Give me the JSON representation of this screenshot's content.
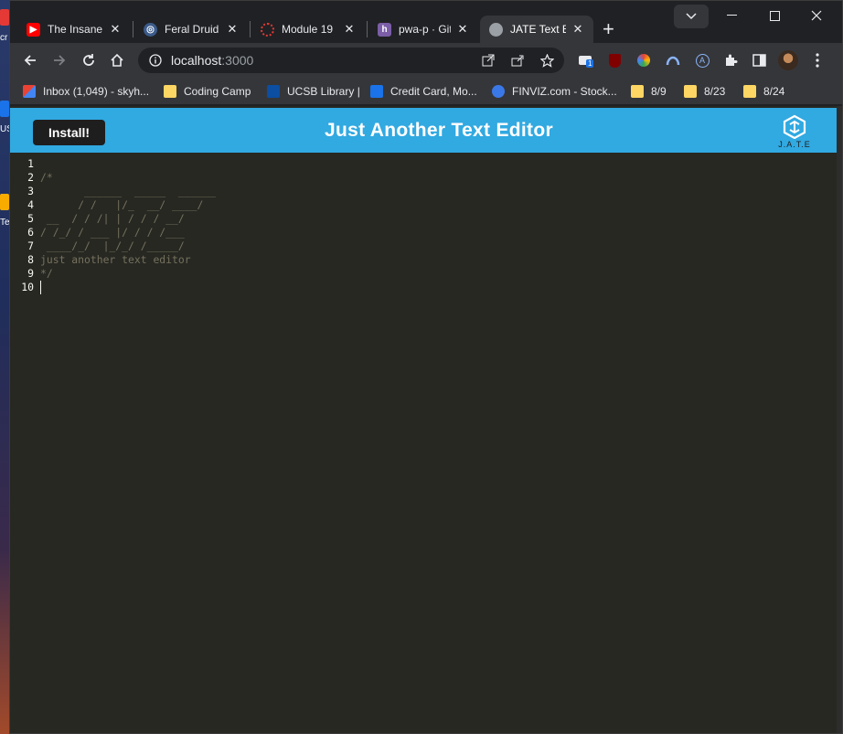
{
  "desktop": {
    "labels": [
      "cr",
      "US",
      "Te"
    ]
  },
  "tabs": [
    {
      "title": "The Insane",
      "favicon": "youtube-icon",
      "color": "#ff0000"
    },
    {
      "title": "Feral Druid",
      "favicon": "globe-icon",
      "color": "#8ab4f8"
    },
    {
      "title": "Module 19",
      "favicon": "ring-icon",
      "color": "#e53935"
    },
    {
      "title": "pwa-p · Gitl",
      "favicon": "heroku-icon",
      "color": "#7b5ea7"
    },
    {
      "title": "JATE Text Ed",
      "favicon": "globe-icon",
      "color": "#9aa0a6"
    }
  ],
  "address": {
    "host": "localhost",
    "port": ":3000"
  },
  "extensions": {
    "badge": "1"
  },
  "bookmarks": [
    {
      "label": "Inbox (1,049) - skyh...",
      "icon": "gmail-icon"
    },
    {
      "label": "Coding Camp",
      "icon": "folder-icon"
    },
    {
      "label": "UCSB Library |",
      "icon": "ucsb-icon"
    },
    {
      "label": "Credit Card, Mo...",
      "icon": "bank-icon"
    },
    {
      "label": "FINVIZ.com - Stock...",
      "icon": "finviz-icon"
    },
    {
      "label": "8/9",
      "icon": "folder-icon"
    },
    {
      "label": "8/23",
      "icon": "folder-icon"
    },
    {
      "label": "8/24",
      "icon": "folder-icon"
    }
  ],
  "app": {
    "install_label": "Install!",
    "title": "Just Another Text Editor",
    "logo_text": "J.A.T.E",
    "colors": {
      "header": "#31a9e1",
      "editor_bg": "#272822"
    }
  },
  "editor": {
    "lines": [
      {
        "num": "1",
        "text": ""
      },
      {
        "num": "2",
        "text": "/*"
      },
      {
        "num": "3",
        "text": "       ______  _____  ______"
      },
      {
        "num": "4",
        "text": "      / /   |/_  __/ ____/"
      },
      {
        "num": "5",
        "text": " __  / / /| | / / / __/"
      },
      {
        "num": "6",
        "text": "/ /_/ / ___ |/ / / /___"
      },
      {
        "num": "7",
        "text": " ____/_/  |_/_/ /_____/"
      },
      {
        "num": "8",
        "text": "just another text editor"
      },
      {
        "num": "9",
        "text": "*/"
      },
      {
        "num": "10",
        "text": ""
      }
    ]
  }
}
